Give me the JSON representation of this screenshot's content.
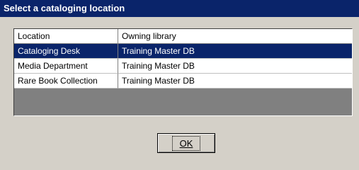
{
  "window": {
    "title": "Select a cataloging location"
  },
  "list": {
    "columns": [
      "Location",
      "Owning library"
    ],
    "rows": [
      {
        "location": "Cataloging Desk",
        "library": "Training Master DB",
        "selected": true
      },
      {
        "location": "Media Department",
        "library": "Training Master DB",
        "selected": false
      },
      {
        "location": "Rare Book Collection",
        "library": "Training Master DB",
        "selected": false
      }
    ]
  },
  "buttons": {
    "ok_label": "OK"
  },
  "colors": {
    "titlebar": "#0a246a",
    "selection": "#0a246a",
    "dialog_bg": "#d4d0c8"
  }
}
